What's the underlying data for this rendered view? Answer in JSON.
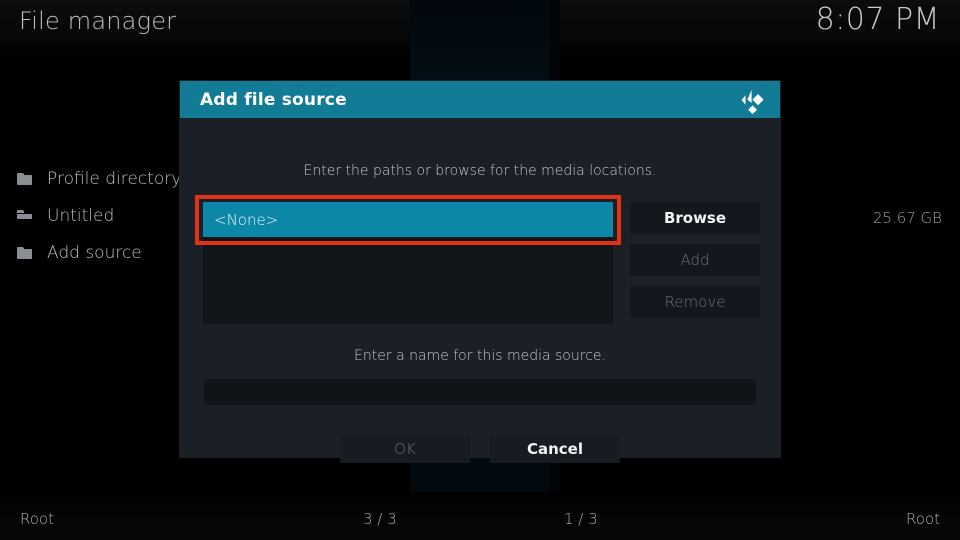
{
  "window": {
    "title": "File manager",
    "clock": "8:07 PM"
  },
  "left_pane": {
    "items": [
      {
        "label": "Profile directory",
        "icon": "folder-icon"
      },
      {
        "label": "Untitled",
        "icon": "folder-open-icon"
      },
      {
        "label": "Add source",
        "icon": "folder-icon"
      }
    ]
  },
  "right_pane": {
    "free_space": "25.67 GB"
  },
  "status_bar": {
    "left_path": "Root",
    "left_count": "3 / 3",
    "right_count": "1 / 3",
    "right_path": "Root"
  },
  "dialog": {
    "title": "Add file source",
    "logo_icon": "kodi-logo-icon",
    "paths_prompt": "Enter the paths or browse for the media locations.",
    "source_list": {
      "items": [
        {
          "label": "<None>",
          "selected": true
        }
      ]
    },
    "buttons": {
      "browse": "Browse",
      "add": "Add",
      "remove": "Remove",
      "ok": "OK",
      "cancel": "Cancel"
    },
    "name_prompt": "Enter a name for this media source.",
    "name_input": {
      "value": "",
      "placeholder": ""
    }
  },
  "colors": {
    "accent_teal": "#127b96",
    "selection_teal": "#0d87a7",
    "highlight_red": "#e33118",
    "dialog_bg": "#1b2027",
    "page_bg": "#000000"
  }
}
